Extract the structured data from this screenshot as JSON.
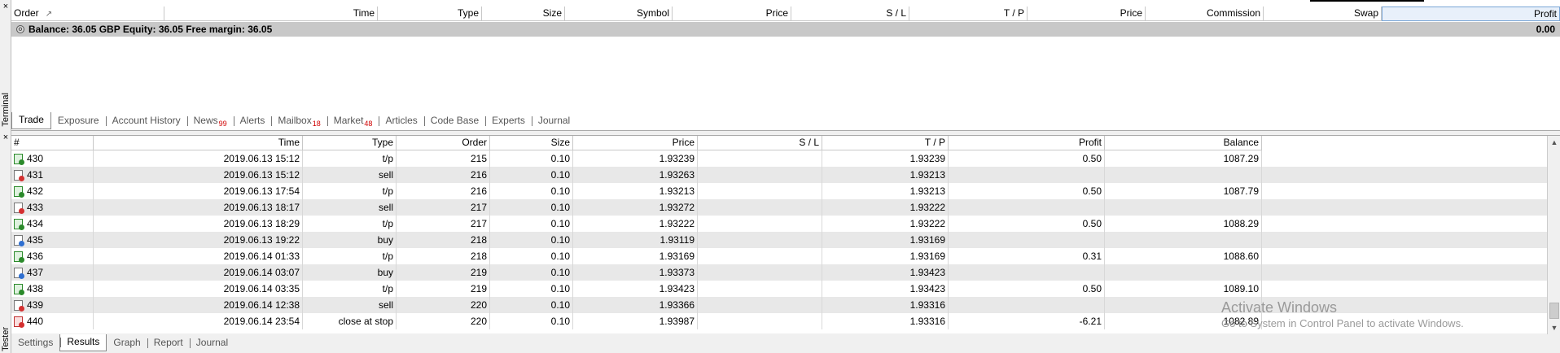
{
  "side": {
    "terminal_label": "Terminal",
    "tester_label": "Tester",
    "close_glyph": "×"
  },
  "terminal": {
    "columns": [
      {
        "label": "Order",
        "w": 188,
        "align": "l"
      },
      {
        "label": "Time",
        "w": 262,
        "align": "r"
      },
      {
        "label": "Type",
        "w": 128,
        "align": "r"
      },
      {
        "label": "Size",
        "w": 102,
        "align": "r"
      },
      {
        "label": "Symbol",
        "w": 132,
        "align": "r"
      },
      {
        "label": "Price",
        "w": 146,
        "align": "r"
      },
      {
        "label": "S / L",
        "w": 145,
        "align": "r"
      },
      {
        "label": "T / P",
        "w": 145,
        "align": "r"
      },
      {
        "label": "Price",
        "w": 145,
        "align": "r"
      },
      {
        "label": "Commission",
        "w": 145,
        "align": "r"
      },
      {
        "label": "Swap",
        "w": 145,
        "align": "r"
      },
      {
        "label": "Profit",
        "w": 219,
        "align": "r"
      }
    ],
    "sort_icon": "↗",
    "balance_text": "Balance: 36.05 GBP  Equity: 36.05  Free margin: 36.05",
    "balance_profit": "0.00",
    "tabs": [
      {
        "label": "Trade",
        "badge": ""
      },
      {
        "label": "Exposure",
        "badge": ""
      },
      {
        "label": "Account History",
        "badge": ""
      },
      {
        "label": "News",
        "badge": "99"
      },
      {
        "label": "Alerts",
        "badge": ""
      },
      {
        "label": "Mailbox",
        "badge": "18"
      },
      {
        "label": "Market",
        "badge": "48"
      },
      {
        "label": "Articles",
        "badge": ""
      },
      {
        "label": "Code Base",
        "badge": ""
      },
      {
        "label": "Experts",
        "badge": ""
      },
      {
        "label": "Journal",
        "badge": ""
      }
    ],
    "active_tab": 0
  },
  "tester": {
    "columns": [
      "#",
      "Time",
      "Type",
      "Order",
      "Size",
      "Price",
      "S / L",
      "T / P",
      "Profit",
      "Balance"
    ],
    "rows": [
      {
        "icon": "green",
        "n": "430",
        "time": "2019.06.13 15:12",
        "type": "t/p",
        "order": "215",
        "size": "0.10",
        "price": "1.93239",
        "sl": "",
        "tp": "1.93239",
        "profit": "0.50",
        "balance": "1087.29"
      },
      {
        "icon": "red",
        "n": "431",
        "time": "2019.06.13 15:12",
        "type": "sell",
        "order": "216",
        "size": "0.10",
        "price": "1.93263",
        "sl": "",
        "tp": "1.93213",
        "profit": "",
        "balance": ""
      },
      {
        "icon": "green",
        "n": "432",
        "time": "2019.06.13 17:54",
        "type": "t/p",
        "order": "216",
        "size": "0.10",
        "price": "1.93213",
        "sl": "",
        "tp": "1.93213",
        "profit": "0.50",
        "balance": "1087.79"
      },
      {
        "icon": "red",
        "n": "433",
        "time": "2019.06.13 18:17",
        "type": "sell",
        "order": "217",
        "size": "0.10",
        "price": "1.93272",
        "sl": "",
        "tp": "1.93222",
        "profit": "",
        "balance": ""
      },
      {
        "icon": "green",
        "n": "434",
        "time": "2019.06.13 18:29",
        "type": "t/p",
        "order": "217",
        "size": "0.10",
        "price": "1.93222",
        "sl": "",
        "tp": "1.93222",
        "profit": "0.50",
        "balance": "1088.29"
      },
      {
        "icon": "blue",
        "n": "435",
        "time": "2019.06.13 19:22",
        "type": "buy",
        "order": "218",
        "size": "0.10",
        "price": "1.93119",
        "sl": "",
        "tp": "1.93169",
        "profit": "",
        "balance": ""
      },
      {
        "icon": "green",
        "n": "436",
        "time": "2019.06.14 01:33",
        "type": "t/p",
        "order": "218",
        "size": "0.10",
        "price": "1.93169",
        "sl": "",
        "tp": "1.93169",
        "profit": "0.31",
        "balance": "1088.60"
      },
      {
        "icon": "blue",
        "n": "437",
        "time": "2019.06.14 03:07",
        "type": "buy",
        "order": "219",
        "size": "0.10",
        "price": "1.93373",
        "sl": "",
        "tp": "1.93423",
        "profit": "",
        "balance": ""
      },
      {
        "icon": "green",
        "n": "438",
        "time": "2019.06.14 03:35",
        "type": "t/p",
        "order": "219",
        "size": "0.10",
        "price": "1.93423",
        "sl": "",
        "tp": "1.93423",
        "profit": "0.50",
        "balance": "1089.10"
      },
      {
        "icon": "red",
        "n": "439",
        "time": "2019.06.14 12:38",
        "type": "sell",
        "order": "220",
        "size": "0.10",
        "price": "1.93366",
        "sl": "",
        "tp": "1.93316",
        "profit": "",
        "balance": ""
      },
      {
        "icon": "redx",
        "n": "440",
        "time": "2019.06.14 23:54",
        "type": "close at stop",
        "order": "220",
        "size": "0.10",
        "price": "1.93987",
        "sl": "",
        "tp": "1.93316",
        "profit": "-6.21",
        "balance": "1082.89"
      }
    ],
    "tabs": [
      "Settings",
      "Results",
      "Graph",
      "Report",
      "Journal"
    ],
    "active_tab": 1
  },
  "watermark": {
    "line1": "Activate Windows",
    "line2": "Go to System in Control Panel to activate Windows."
  }
}
